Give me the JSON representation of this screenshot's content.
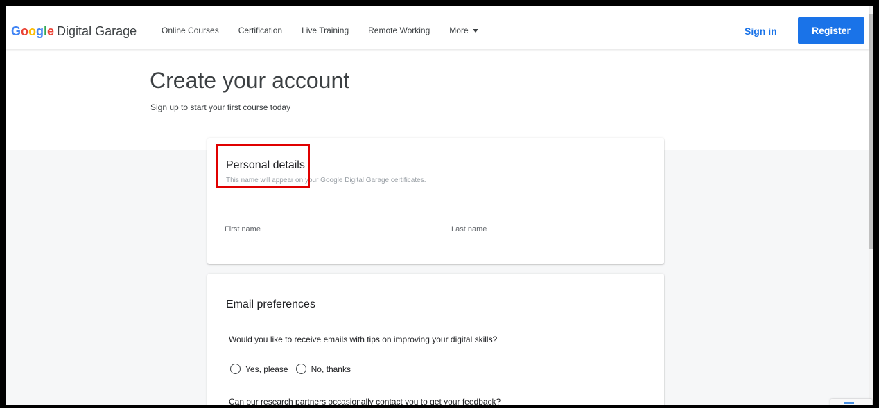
{
  "header": {
    "logo_google": [
      "G",
      "o",
      "o",
      "g",
      "l",
      "e"
    ],
    "logo_google_colors": [
      "#4285F4",
      "#EA4335",
      "#FBBC05",
      "#4285F4",
      "#34A853",
      "#EA4335"
    ],
    "logo_rest": "Digital Garage",
    "nav": [
      {
        "label": "Online Courses"
      },
      {
        "label": "Certification"
      },
      {
        "label": "Live Training"
      },
      {
        "label": "Remote Working"
      },
      {
        "label": "More"
      }
    ],
    "signin_label": "Sign in",
    "register_label": "Register"
  },
  "hero": {
    "title": "Create your account",
    "subtitle": "Sign up to start your first course today"
  },
  "personal": {
    "title": "Personal details",
    "description": "This name will appear on your Google Digital Garage certificates.",
    "first_name_placeholder": "First name",
    "last_name_placeholder": "Last name"
  },
  "email": {
    "title": "Email preferences",
    "question1": "Would you like to receive emails with tips on improving your digital skills?",
    "option_yes": "Yes, please",
    "option_no": "No, thanks",
    "question2": "Can our research partners occasionally contact you to get your feedback?"
  },
  "colors": {
    "accent": "#1a73e8",
    "highlight": "#e00000"
  },
  "icons": {
    "more": "chevron-down-icon",
    "radio": "radio-unchecked-icon"
  }
}
